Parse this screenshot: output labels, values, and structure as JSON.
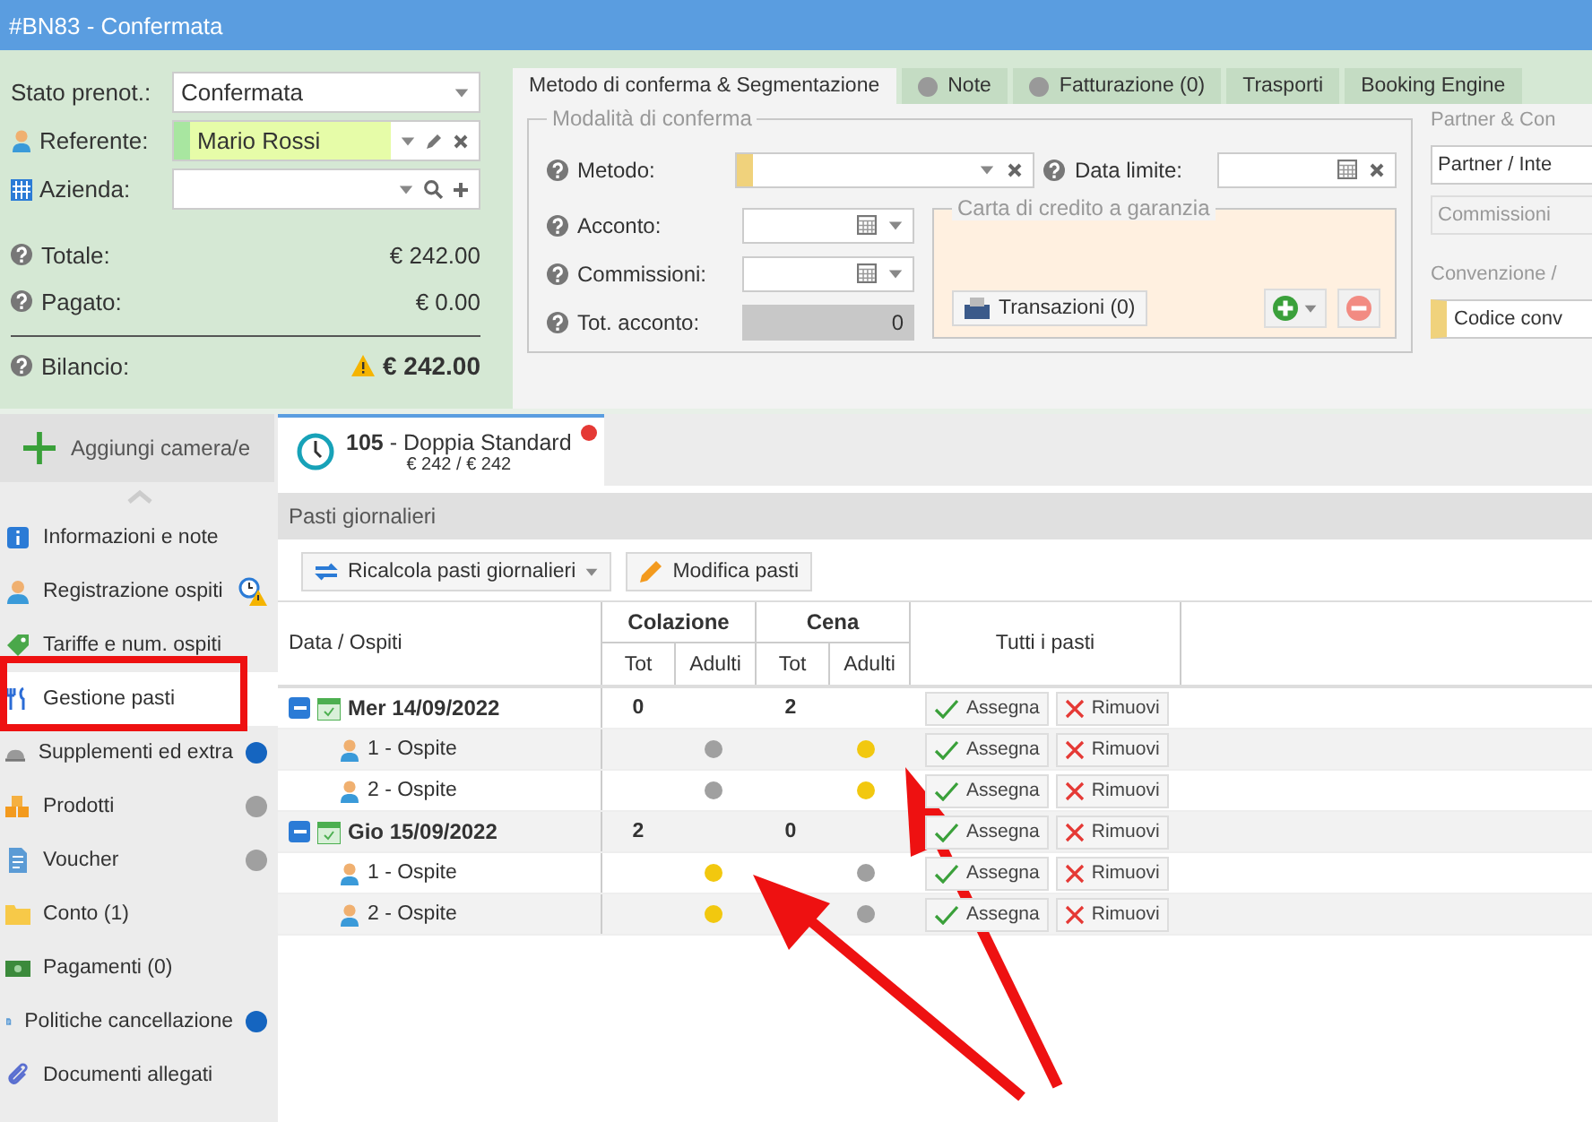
{
  "window": {
    "title": "#BN83 - Confermata"
  },
  "booking": {
    "fields": [
      {
        "label": "Stato prenot.:",
        "value": "Confermata",
        "kind": "status"
      },
      {
        "label": "Referente:",
        "value": "Mario Rossi",
        "kind": "person"
      },
      {
        "label": "Azienda:",
        "kind": "company"
      }
    ],
    "totals": [
      {
        "label": "Totale:",
        "value": "€ 242.00",
        "warning": false
      },
      {
        "label": "Pagato:",
        "value": "€ 0.00",
        "warning": false
      },
      {
        "label": "Bilancio:",
        "value": "€ 242.00",
        "warning": true
      }
    ]
  },
  "tabs": [
    {
      "label": "Metodo di conferma & Segmentazione",
      "selected": true,
      "indicator": false
    },
    {
      "label": "Note",
      "selected": false,
      "indicator": true
    },
    {
      "label": "Fatturazione (0)",
      "selected": false,
      "indicator": true
    },
    {
      "label": "Trasporti",
      "selected": false,
      "indicator": false
    },
    {
      "label": "Booking Engine",
      "selected": false,
      "indicator": false
    }
  ],
  "confirm": {
    "legend": "Modalità di conferma",
    "method_label": "Metodo:",
    "deadline_label": "Data limite:",
    "deposit_label": "Acconto:",
    "commission_label": "Commissioni:",
    "total_deposit_label": "Tot. acconto:",
    "total_deposit_value": "0",
    "card": {
      "legend": "Carta di credito a garanzia",
      "transactions_button": "Transazioni (0)"
    }
  },
  "partner": {
    "legend": "Partner & Con",
    "select_value": "Partner / Inte",
    "commission_placeholder": "Commissioni",
    "convention_legend": "Convenzione /",
    "convention_placeholder": "Codice conv"
  },
  "add_room": "Aggiungi camera/e",
  "sidebar": {
    "items": [
      {
        "label": "Informazioni e note",
        "kind": "info",
        "selected": false
      },
      {
        "label": "Registrazione ospiti",
        "kind": "person",
        "selected": false,
        "badge": {
          "kind": "warning"
        }
      },
      {
        "label": "Tariffe e num. ospiti",
        "kind": "tag",
        "selected": false
      },
      {
        "label": "Gestione pasti",
        "kind": "cutlery",
        "selected": true
      },
      {
        "label": "Supplementi ed extra",
        "kind": "bell",
        "selected": false,
        "badge": {
          "kind": "dot",
          "color": "#1565c0"
        }
      },
      {
        "label": "Prodotti",
        "kind": "boxes",
        "selected": false,
        "badge": {
          "kind": "dot",
          "color": "#a0a0a0"
        }
      },
      {
        "label": "Voucher",
        "kind": "document",
        "selected": false,
        "badge": {
          "kind": "dot",
          "color": "#a0a0a0"
        }
      },
      {
        "label": "Conto (1)",
        "kind": "folder",
        "selected": false
      },
      {
        "label": "Pagamenti (0)",
        "kind": "cash",
        "selected": false
      },
      {
        "label": "Politiche cancellazione",
        "kind": "document",
        "selected": false,
        "badge": {
          "kind": "dot",
          "color": "#1565c0"
        }
      },
      {
        "label": "Documenti allegati",
        "kind": "paperclip",
        "selected": false
      }
    ]
  },
  "room_tab": {
    "title": "**105** - Doppia Standard",
    "price": "€ 242 / € 242",
    "selected": true
  },
  "panel": {
    "title": "Pasti giornalieri",
    "buttons": [
      {
        "label": "Ricalcola pasti giornalieri",
        "kind": "recalc"
      },
      {
        "label": "Modifica pasti",
        "kind": "edit"
      }
    ]
  },
  "table": {
    "first_column": "Data / Ospiti",
    "groups": [
      {
        "label": "Colazione",
        "columns": [
          "Tot",
          "Adulti"
        ]
      },
      {
        "label": "Cena",
        "columns": [
          "Tot",
          "Adulti"
        ]
      }
    ],
    "all_meals": "Tutti i pasti",
    "rows": [
      {
        "label": "Mer 14/09/2022",
        "expanded": true,
        "totals": [
          "0",
          "2"
        ],
        "assign": "Assegna",
        "remove": "Rimuovi",
        "children": [
          {
            "label": "1 - Ospite",
            "meals": [
              false,
              true
            ],
            "assign": "Assegna",
            "remove": "Rimuovi"
          },
          {
            "label": "2 - Ospite",
            "meals": [
              false,
              true
            ],
            "assign": "Assegna",
            "remove": "Rimuovi"
          }
        ]
      },
      {
        "label": "Gio 15/09/2022",
        "expanded": true,
        "totals": [
          "2",
          "0"
        ],
        "assign": "Assegna",
        "remove": "Rimuovi",
        "children": [
          {
            "label": "1 - Ospite",
            "meals": [
              true,
              false
            ],
            "assign": "Assegna",
            "remove": "Rimuovi"
          },
          {
            "label": "2 - Ospite",
            "meals": [
              true,
              false
            ],
            "assign": "Assegna",
            "remove": "Rimuovi"
          }
        ]
      }
    ]
  }
}
